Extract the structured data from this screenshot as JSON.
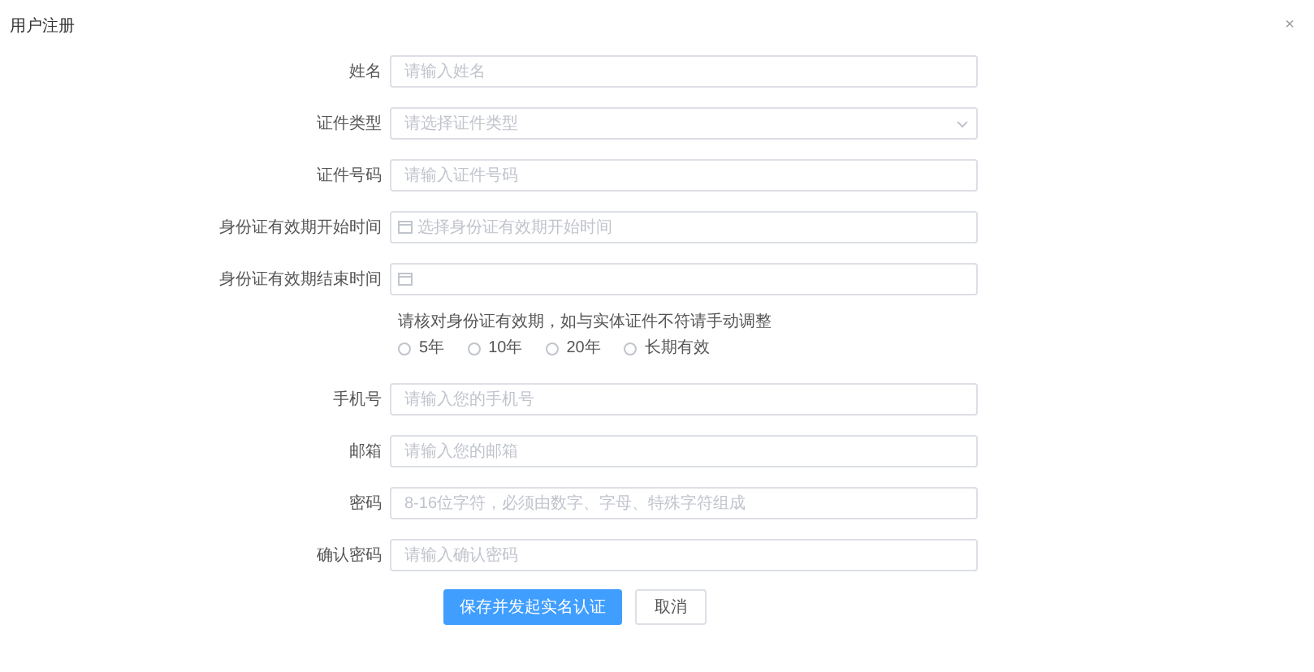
{
  "window": {
    "title": "用户注册",
    "close": "×"
  },
  "fields_top": [
    {
      "label": "姓名",
      "kind": "text",
      "placeholder": "请输入姓名"
    },
    {
      "label": "证件类型",
      "kind": "select",
      "placeholder": "请选择证件类型"
    },
    {
      "label": "证件号码",
      "kind": "text",
      "placeholder": "请输入证件号码"
    },
    {
      "label": "身份证有效期开始时间",
      "kind": "date",
      "placeholder": "选择身份证有效期开始时间"
    },
    {
      "label": "身份证有效期结束时间",
      "kind": "date"
    }
  ],
  "validity": {
    "hint": "请核对身份证有效期，如与实体证件不符请手动调整",
    "options": [
      {
        "label": "5年",
        "selected": false
      },
      {
        "label": "10年",
        "selected": false
      },
      {
        "label": "20年",
        "selected": false
      },
      {
        "label": "长期有效",
        "selected": false
      }
    ]
  },
  "fields_bottom": [
    {
      "label": "手机号",
      "kind": "text",
      "placeholder": "请输入您的手机号"
    },
    {
      "label": "邮箱",
      "kind": "text",
      "placeholder": "请输入您的邮箱"
    },
    {
      "label": "密码",
      "kind": "text",
      "placeholder": "8-16位字符，必须由数字、字母、特殊字符组成"
    },
    {
      "label": "确认密码",
      "kind": "text",
      "placeholder": "请输入确认密码"
    }
  ],
  "buttons": [
    {
      "label": "保存并发起实名认证",
      "kind": "primary"
    },
    {
      "label": "取消",
      "kind": "default"
    }
  ]
}
